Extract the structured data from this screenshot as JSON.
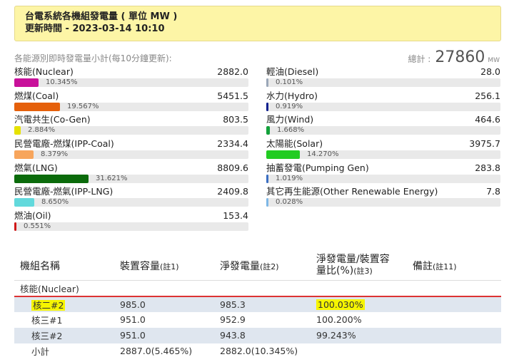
{
  "banner": {
    "title": "台電系統各機組發電量 ( 單位 MW )",
    "updated": "更新時間 - 2023-03-14 10:10"
  },
  "summary": {
    "subtitle": "各能源別即時發電量小計(每10分鐘更新):",
    "total_label": "總計 :",
    "total_value": "27860",
    "total_unit": "MW"
  },
  "sources_left": [
    {
      "label": "核能(Nuclear)",
      "value": "2882.0",
      "pct": "10.345%",
      "frac": 0.10345,
      "color": "#c8119a"
    },
    {
      "label": "燃煤(Coal)",
      "value": "5451.5",
      "pct": "19.567%",
      "frac": 0.19567,
      "color": "#e5600b"
    },
    {
      "label": "汽電共生(Co-Gen)",
      "value": "803.5",
      "pct": "2.884%",
      "frac": 0.02884,
      "color": "#e6e200"
    },
    {
      "label": "民營電廠-燃煤(IPP-Coal)",
      "value": "2334.4",
      "pct": "8.379%",
      "frac": 0.08379,
      "color": "#f7a55c"
    },
    {
      "label": "燃氣(LNG)",
      "value": "8809.6",
      "pct": "31.621%",
      "frac": 0.31621,
      "color": "#0b6b0b"
    },
    {
      "label": "民營電廠-燃氣(IPP-LNG)",
      "value": "2409.8",
      "pct": "8.650%",
      "frac": 0.0865,
      "color": "#62d9dc"
    },
    {
      "label": "燃油(Oil)",
      "value": "153.4",
      "pct": "0.551%",
      "frac": 0.00551,
      "color": "#d01818"
    }
  ],
  "sources_right": [
    {
      "label": "輕油(Diesel)",
      "value": "28.0",
      "pct": "0.101%",
      "frac": 0.00101,
      "color": "#9aa7b8"
    },
    {
      "label": "水力(Hydro)",
      "value": "256.1",
      "pct": "0.919%",
      "frac": 0.00919,
      "color": "#0d1f8e"
    },
    {
      "label": "風力(Wind)",
      "value": "464.6",
      "pct": "1.668%",
      "frac": 0.01668,
      "color": "#13a13b"
    },
    {
      "label": "太陽能(Solar)",
      "value": "3975.7",
      "pct": "14.270%",
      "frac": 0.1427,
      "color": "#22cc22"
    },
    {
      "label": "抽蓄發電(Pumping Gen)",
      "value": "283.8",
      "pct": "1.019%",
      "frac": 0.01019,
      "color": "#3a6ec2"
    },
    {
      "label": "其它再生能源(Other Renewable Energy)",
      "value": "7.8",
      "pct": "0.028%",
      "frac": 0.00028,
      "color": "#7db7e6"
    }
  ],
  "table": {
    "headers": {
      "name": "機組名稱",
      "capacity": "裝置容量",
      "capacity_note": "(註1)",
      "net": "淨發電量",
      "net_note": "(註2)",
      "ratio_line1": "淨發電量/裝置容",
      "ratio_line2": "量比(%)",
      "ratio_note": "(註3)",
      "remark": "備註",
      "remark_note": "(註11)"
    },
    "group": "核能(Nuclear)",
    "rows": [
      {
        "name": "核二#2",
        "capacity": "985.0",
        "net": "985.3",
        "ratio": "100.030%"
      },
      {
        "name": "核三#1",
        "capacity": "951.0",
        "net": "952.9",
        "ratio": "100.200%"
      },
      {
        "name": "核三#2",
        "capacity": "951.0",
        "net": "943.8",
        "ratio": "99.243%"
      },
      {
        "name": "小計",
        "capacity": "2887.0(5.465%)",
        "net": "2882.0(10.345%)",
        "ratio": ""
      }
    ]
  }
}
